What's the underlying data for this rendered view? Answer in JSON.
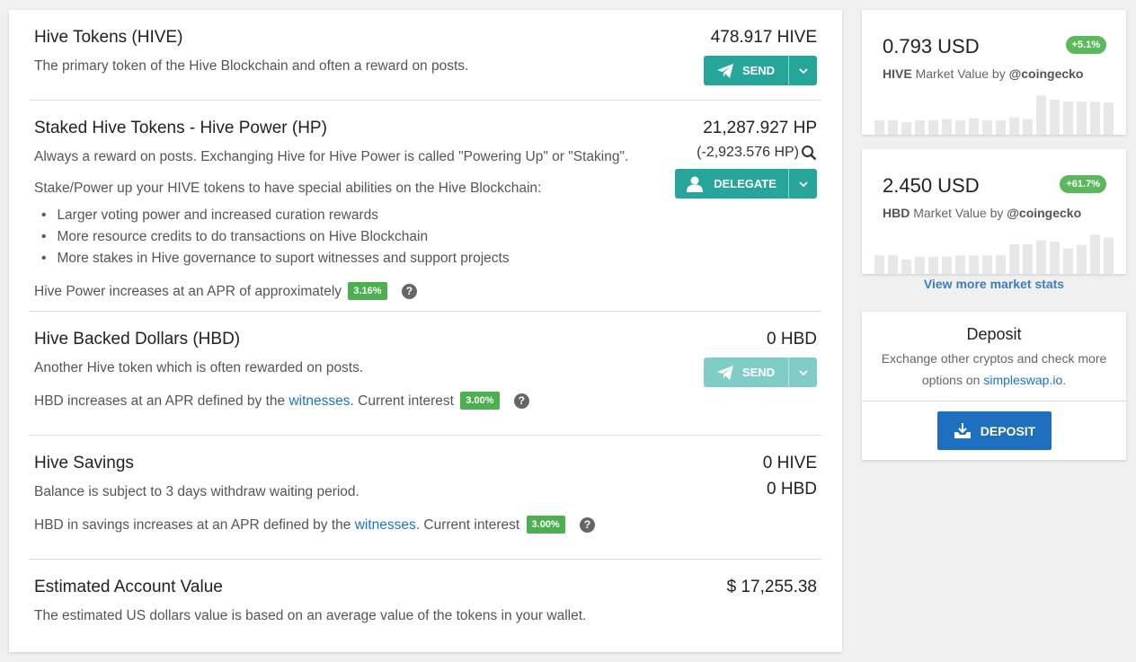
{
  "hive": {
    "title": "Hive Tokens (HIVE)",
    "description": "The primary token of the Hive Blockchain and often a reward on posts.",
    "amount": "478.917 HIVE",
    "button": "SEND"
  },
  "hp": {
    "title": "Staked Hive Tokens - Hive Power (HP)",
    "description": "Always a reward on posts. Exchanging Hive for Hive Power is called \"Powering Up\" or \"Staking\".",
    "stake_intro": "Stake/Power up your HIVE tokens to have special abilities on the Hive Blockchain:",
    "features": [
      "Larger voting power and increased curation rewards",
      "More resource credits to do transactions on Hive Blockchain",
      "More stakes in Hive governance to suport witnesses and support projects"
    ],
    "apr_text": "Hive Power increases at an APR of approximately",
    "apr_badge": "3.16%",
    "amount": "21,287.927 HP",
    "delegated": "(-2,923.576 HP)",
    "button": "DELEGATE"
  },
  "hbd": {
    "title": "Hive Backed Dollars (HBD)",
    "description": "Another Hive token which is often rewarded on posts.",
    "apr_prefix": "HBD increases at an APR defined by the",
    "apr_link": "witnesses",
    "apr_suffix": ". Current interest",
    "apr_badge": "3.00%",
    "amount": "0 HBD",
    "button": "SEND"
  },
  "savings": {
    "title": "Hive Savings",
    "description": "Balance is subject to 3 days withdraw waiting period.",
    "apr_prefix": "HBD in savings increases at an APR defined by the",
    "apr_link": "witnesses",
    "apr_suffix": ". Current interest",
    "apr_badge": "3.00%",
    "amount_hive": "0 HIVE",
    "amount_hbd": "0 HBD"
  },
  "estimate": {
    "title": "Estimated Account Value",
    "description": "The estimated US dollars value is based on an average value of the tokens in your wallet.",
    "amount": "$ 17,255.38"
  },
  "market_hive": {
    "price": "0.793 USD",
    "change": "+5.1%",
    "token": "HIVE",
    "label": "Market Value by",
    "source": "@coingecko",
    "bars": [
      0.35,
      0.35,
      0.3,
      0.35,
      0.35,
      0.38,
      0.35,
      0.4,
      0.35,
      0.35,
      0.42,
      0.38,
      0.95,
      0.85,
      0.8,
      0.8,
      0.8,
      0.78
    ]
  },
  "market_hbd": {
    "price": "2.450 USD",
    "change": "+61.7%",
    "token": "HBD",
    "label": "Market Value by",
    "source": "@coingecko",
    "bars": [
      0.45,
      0.45,
      0.35,
      0.42,
      0.42,
      0.42,
      0.45,
      0.45,
      0.45,
      0.45,
      0.72,
      0.72,
      0.82,
      0.78,
      0.62,
      0.7,
      0.95,
      0.88
    ]
  },
  "view_more": "View more market stats",
  "deposit": {
    "title": "Deposit",
    "desc_prefix": "Exchange other cryptos and check more options on",
    "desc_link": "simpleswap.io",
    "desc_suffix": ".",
    "button": "DEPOSIT"
  },
  "colors": {
    "teal": "#26a69a",
    "green_badge": "#4caf50",
    "link": "#1a73c8",
    "deposit_blue": "#1f6fbf",
    "bar_gray": "#e8e8e8"
  }
}
